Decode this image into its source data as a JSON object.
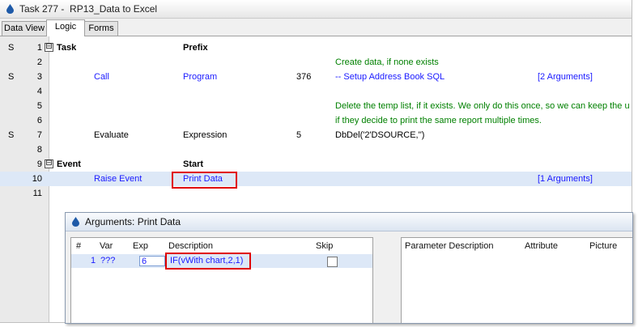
{
  "window": {
    "title": "Task 277 -  RP13_Data to Excel"
  },
  "tabs": [
    {
      "label": "Data View"
    },
    {
      "label": "Logic"
    },
    {
      "label": "Forms"
    }
  ],
  "rows": [
    {
      "s": "S",
      "n": "1",
      "toggle": "⊟",
      "c1": "Task",
      "c2": "Prefix",
      "c3": "",
      "c4": "",
      "c5": ""
    },
    {
      "s": "",
      "n": "2",
      "c1": "",
      "c2": "",
      "c3": "",
      "c4": "Create data, if none exists",
      "c5": ""
    },
    {
      "s": "S",
      "n": "3",
      "c1": "Call",
      "c2": "Program",
      "c3": "376",
      "c4": "-- Setup Address Book SQL",
      "c5": "[2 Arguments]"
    },
    {
      "s": "",
      "n": "4",
      "c1": "",
      "c2": "",
      "c3": "",
      "c4": "",
      "c5": ""
    },
    {
      "s": "",
      "n": "5",
      "c1": "",
      "c2": "",
      "c3": "",
      "c4": "Delete the temp list, if it exists. We only do this once, so we can keep the u",
      "c5": ""
    },
    {
      "s": "",
      "n": "6",
      "c1": "",
      "c2": "",
      "c3": "",
      "c4": "if they decide to print the same report multiple times.",
      "c5": ""
    },
    {
      "s": "S",
      "n": "7",
      "c1": "Evaluate",
      "c2": "Expression",
      "c3": "5",
      "c4": "DbDel('2'DSOURCE,'')",
      "c5": ""
    },
    {
      "s": "",
      "n": "8",
      "c1": "",
      "c2": "",
      "c3": "",
      "c4": "",
      "c5": ""
    },
    {
      "s": "",
      "n": "9",
      "toggle": "⊟",
      "c1": "Event",
      "c2": "Start",
      "c3": "",
      "c4": "",
      "c5": ""
    },
    {
      "s": "",
      "n": "10",
      "c1": "Raise Event",
      "c2": "Print Data",
      "c3": "",
      "c4": "",
      "c5": "[1 Arguments]"
    },
    {
      "s": "",
      "n": "11",
      "c1": "",
      "c2": "",
      "c3": "",
      "c4": "",
      "c5": ""
    }
  ],
  "dialog": {
    "title": "Arguments: Print Data",
    "headers": {
      "num": "#",
      "var": "Var",
      "exp": "Exp",
      "desc": "Description",
      "skip": "Skip"
    },
    "arg": {
      "num": "1",
      "var": "???",
      "exp": "6",
      "desc": "IF(vWith chart,2,1)"
    },
    "param_headers": {
      "desc": "Parameter Description",
      "attr": "Attribute",
      "pic": "Picture"
    }
  },
  "colors": {
    "blue_text": "#1a1aff",
    "green_comment": "#008000",
    "highlight": "#e00000"
  },
  "icons": {
    "title": "droplet-icon",
    "dialog": "droplet-icon",
    "fold": "minus-box-icon"
  }
}
